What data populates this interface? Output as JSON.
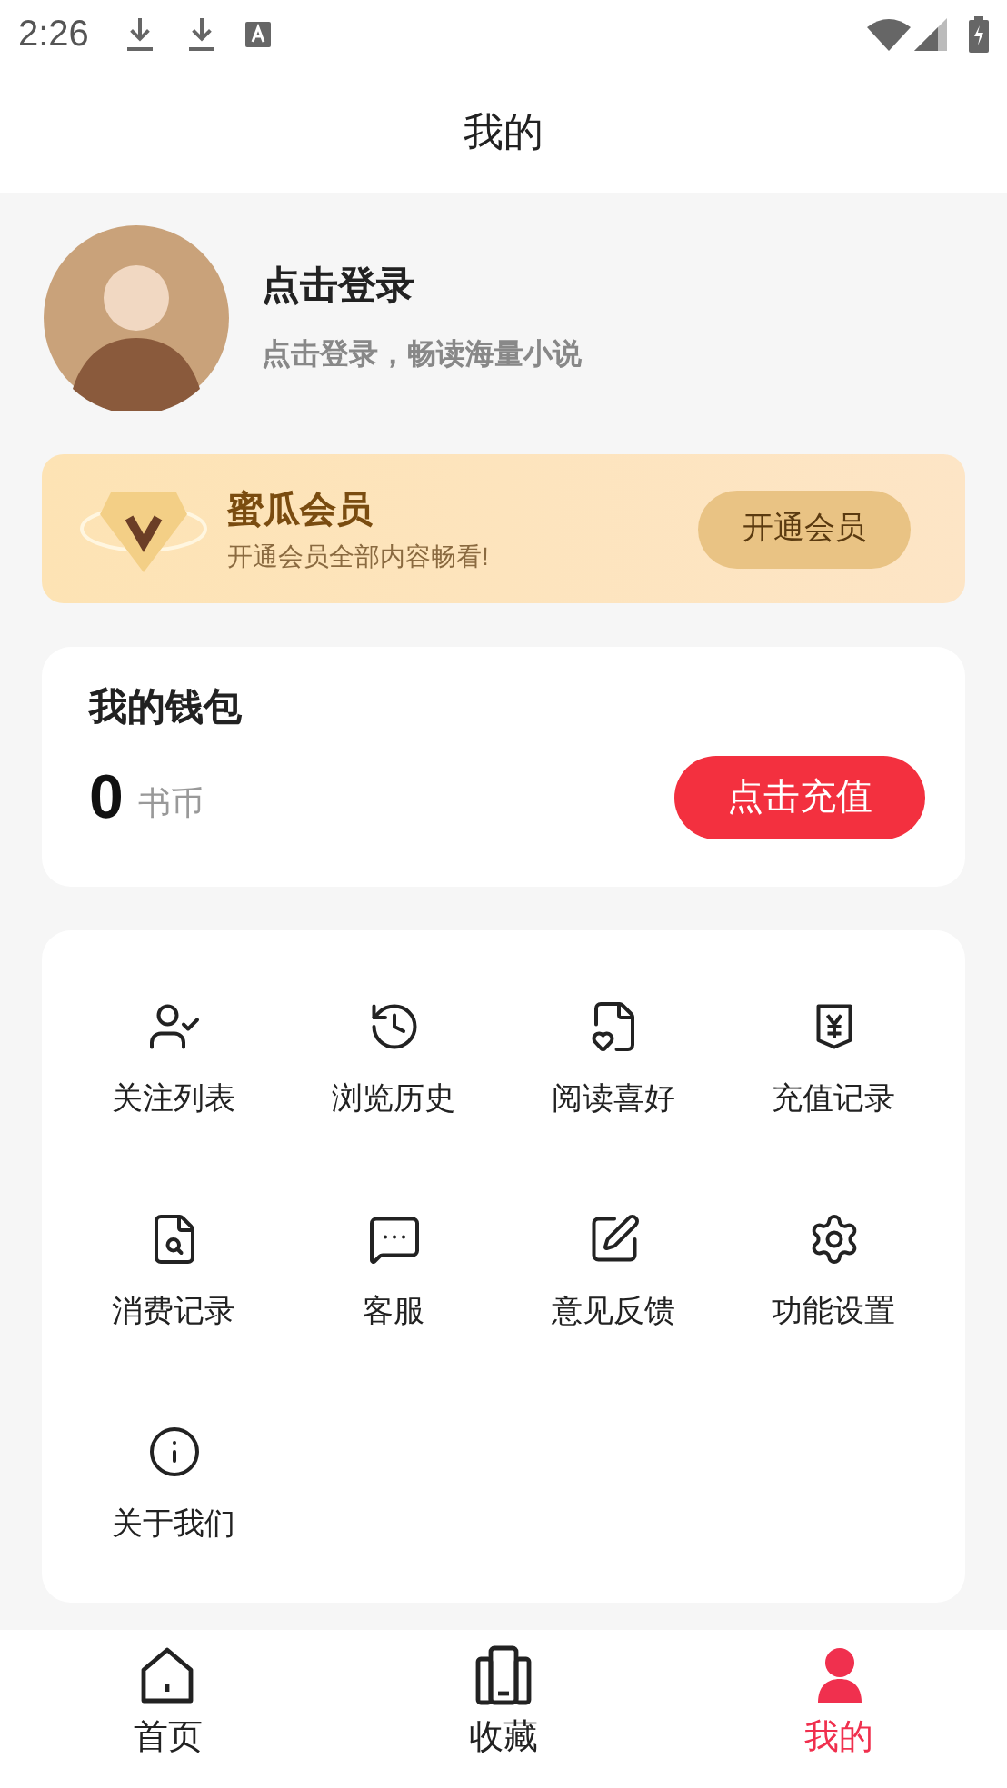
{
  "status_bar": {
    "time": "2:26"
  },
  "header": {
    "title": "我的"
  },
  "profile": {
    "name": "点击登录",
    "subtitle": "点击登录，畅读海量小说"
  },
  "vip": {
    "title": "蜜瓜会员",
    "subtitle": "开通会员全部内容畅看!",
    "button": "开通会员"
  },
  "wallet": {
    "title": "我的钱包",
    "balance": "0",
    "unit": "书币",
    "button": "点击充值"
  },
  "menu": [
    {
      "label": "关注列表"
    },
    {
      "label": "浏览历史"
    },
    {
      "label": "阅读喜好"
    },
    {
      "label": "充值记录"
    },
    {
      "label": "消费记录"
    },
    {
      "label": "客服"
    },
    {
      "label": "意见反馈"
    },
    {
      "label": "功能设置"
    },
    {
      "label": "关于我们"
    }
  ],
  "bottom_nav": [
    {
      "label": "首页",
      "selected": false
    },
    {
      "label": "收藏",
      "selected": false
    },
    {
      "label": "我的",
      "selected": true
    }
  ]
}
